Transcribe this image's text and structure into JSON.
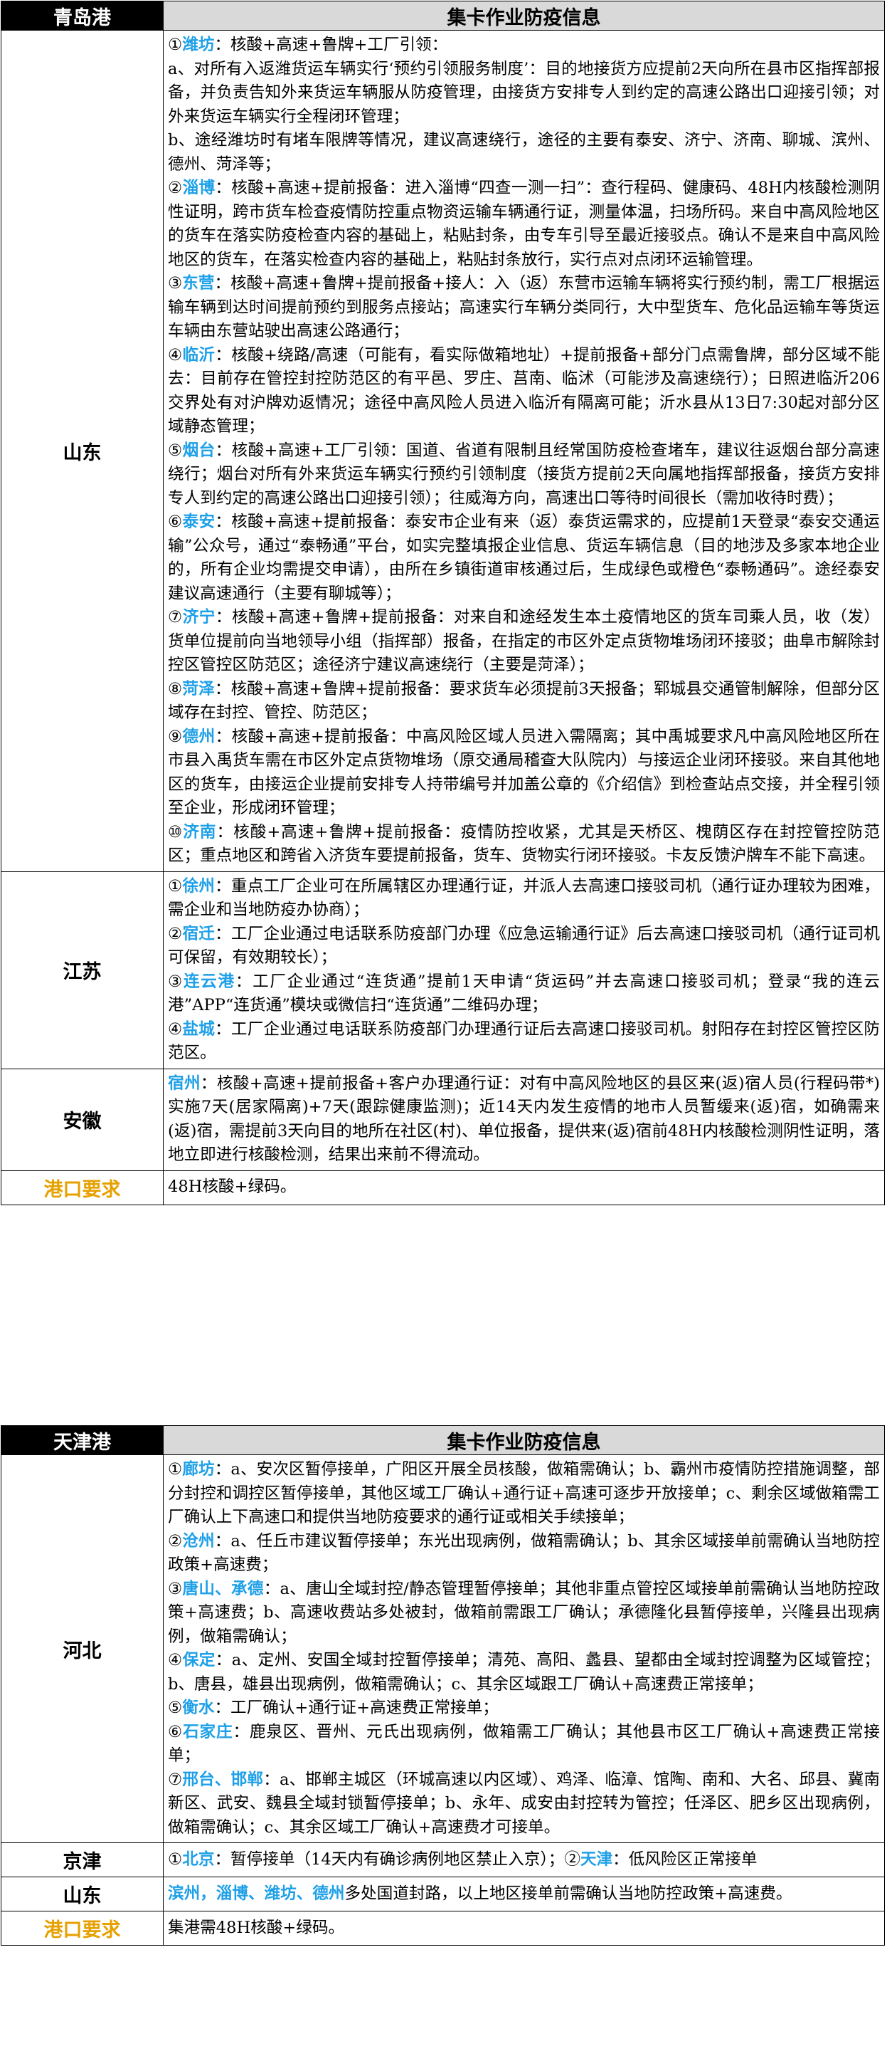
{
  "qingdao": {
    "header_port": "青岛港",
    "header_title": "集卡作业防疫信息",
    "shandong": {
      "region": "山东",
      "items": [
        {
          "num": "①",
          "city": "潍坊",
          "text": "：核酸+高速+鲁牌+工厂引领：\na、对所有入返潍货运车辆实行‘预约引领服务制度’：目的地接货方应提前2天向所在县市区指挥部报备，并负责告知外来货运车辆服从防疫管理，由接货方安排专人到约定的高速公路出口迎接引领；对外来货运车辆实行全程闭环管理；\nb、途经潍坊时有堵车限牌等情况，建议高速绕行，途径的主要有泰安、济宁、济南、聊城、滨州、德州、菏泽等；"
        },
        {
          "num": "②",
          "city": "淄博",
          "text": "：核酸+高速+提前报备：进入淄博“四查一测一扫”：查行程码、健康码、48H内核酸检测阴性证明，跨市货车检查疫情防控重点物资运输车辆通行证，测量体温，扫场所码。来自中高风险地区的货车在落实防疫检查内容的基础上，粘贴封条，由专车引导至最近接驳点。确认不是来自中高风险地区的货车，在落实检查内容的基础上，粘贴封条放行，实行点对点闭环运输管理。"
        },
        {
          "num": "③",
          "city": "东营",
          "text": "：核酸+高速+鲁牌+提前报备+接人：入（返）东营市运输车辆将实行预约制，需工厂根据运输车辆到达时间提前预约到服务点接站；高速实行车辆分类同行，大中型货车、危化品运输车等货运车辆由东营站驶出高速公路通行；"
        },
        {
          "num": "④",
          "city": "临沂",
          "text": "：核酸+绕路/高速（可能有，看实际做箱地址）+提前报备+部分门点需鲁牌，部分区域不能去：目前存在管控封控防范区的有平邑、罗庄、莒南、临沭（可能涉及高速绕行）；日照进临沂206交界处有对沪牌劝返情况；途径中高风险人员进入临沂有隔离可能；沂水县从13日7:30起对部分区域静态管理；"
        },
        {
          "num": "⑤",
          "city": "烟台",
          "text": "：核酸+高速+工厂引领：国道、省道有限制且经常国防疫检查堵车，建议往返烟台部分高速绕行；烟台对所有外来货运车辆实行预约引领制度（接货方提前2天向属地指挥部报备，接货方安排专人到约定的高速公路出口迎接引领）；往威海方向，高速出口等待时间很长（需加收待时费）；"
        },
        {
          "num": "⑥",
          "city": "泰安",
          "text": "：核酸+高速+提前报备：泰安市企业有来（返）泰货运需求的，应提前1天登录“泰安交通运输”公众号，通过“泰畅通”平台，如实完整填报企业信息、货运车辆信息（目的地涉及多家本地企业的，所有企业均需提交申请），由所在乡镇街道审核通过后，生成绿色或橙色“泰畅通码”。途经泰安建议高速通行（主要有聊城等）；"
        },
        {
          "num": "⑦",
          "city": "济宁",
          "text": "：核酸+高速+鲁牌+提前报备：对来自和途经发生本土疫情地区的货车司乘人员，收（发）货单位提前向当地领导小组（指挥部）报备，在指定的市区外定点货物堆场闭环接驳；曲阜市解除封控区管控区防范区；途径济宁建议高速绕行（主要是菏泽）；"
        },
        {
          "num": "⑧",
          "city": "菏泽",
          "text": "：核酸+高速+鲁牌+提前报备：要求货车必须提前3天报备；郓城县交通管制解除，但部分区域存在封控、管控、防范区；"
        },
        {
          "num": "⑨",
          "city": "德州",
          "text": "：核酸+高速+提前报备：中高风险区域人员进入需隔离；其中禹城要求凡中高风险地区所在市县入禹货车需在市区外定点货物堆场（原交通局稽查大队院内）与接运企业闭环接驳。来自其他地区的货车，由接运企业提前安排专人持带编号并加盖公章的《介绍信》到检查站点交接，并全程引领至企业，形成闭环管理；"
        },
        {
          "num": "⑩",
          "city": "济南",
          "text": "：核酸+高速+鲁牌+提前报备：疫情防控收紧，尤其是天桥区、槐荫区存在封控管控防范区；重点地区和跨省入济货车要提前报备，货车、货物实行闭环接驳。卡友反馈沪牌车不能下高速。"
        }
      ]
    },
    "jiangsu": {
      "region": "江苏",
      "items": [
        {
          "num": "①",
          "city": "徐州",
          "text": "：重点工厂企业可在所属辖区办理通行证，并派人去高速口接驳司机（通行证办理较为困难，需企业和当地防疫办协商）；"
        },
        {
          "num": "②",
          "city": "宿迁",
          "text": "：工厂企业通过电话联系防疫部门办理《应急运输通行证》后去高速口接驳司机（通行证司机可保留，有效期较长）；"
        },
        {
          "num": "③",
          "city": "连云港",
          "text": "：工厂企业通过“连货通”提前1天申请“货运码”并去高速口接驳司机；登录“我的连云港”APP“连货通”模块或微信扫“连货通”二维码办理；"
        },
        {
          "num": "④",
          "city": "盐城",
          "text": "：工厂企业通过电话联系防疫部门办理通行证后去高速口接驳司机。射阳存在封控区管控区防范区。"
        }
      ]
    },
    "anhui": {
      "region": "安徽",
      "items": [
        {
          "num": "",
          "city": "宿州",
          "text": "：核酸+高速+提前报备+客户办理通行证：对有中高风险地区的县区来(返)宿人员(行程码带*)实施7天(居家隔离)+7天(跟踪健康监测)；近14天内发生疫情的地市人员暂缓来(返)宿，如确需来(返)宿，需提前3天向目的地所在社区(村)、单位报备，提供来(返)宿前48H内核酸检测阴性证明，落地立即进行核酸检测，结果出来前不得流动。"
        }
      ]
    },
    "port_req": {
      "region": "港口要求",
      "text": "48H核酸+绿码。"
    }
  },
  "tianjin": {
    "header_port": "天津港",
    "header_title": "集卡作业防疫信息",
    "hebei": {
      "region": "河北",
      "items": [
        {
          "num": "①",
          "city": "廊坊",
          "text": "：a、安次区暂停接单，广阳区开展全员核酸，做箱需确认；b、霸州市疫情防控措施调整，部分封控和调控区暂停接单，其他区域工厂确认+通行证+高速可逐步开放接单；c、剩余区域做箱需工厂确认上下高速口和提供当地防疫要求的通行证或相关手续接单；"
        },
        {
          "num": "②",
          "city": "沧州",
          "text": "：a、任丘市建议暂停接单；东光出现病例，做箱需确认；b、其余区域接单前需确认当地防控政策+高速费；"
        },
        {
          "num": "③",
          "city": "唐山、承德",
          "text": "：a、唐山全域封控/静态管理暂停接单；其他非重点管控区域接单前需确认当地防控政策+高速费；b、高速收费站多处被封，做箱前需跟工厂确认；承德隆化县暂停接单，兴隆县出现病例，做箱需确认；"
        },
        {
          "num": "④",
          "city": "保定",
          "text": "：a、定州、安国全域封控暂停接单；清苑、高阳、蠡县、望都由全域封控调整为区域管控；b、唐县，雄县出现病例，做箱需确认；c、其余区域跟工厂确认+高速费正常接单；"
        },
        {
          "num": "⑤",
          "city": "衡水",
          "text": "：工厂确认+通行证+高速费正常接单；"
        },
        {
          "num": "⑥",
          "city": "石家庄",
          "text": "：鹿泉区、晋州、元氏出现病例，做箱需工厂确认；其他县市区工厂确认+高速费正常接单；"
        },
        {
          "num": "⑦",
          "city": "邢台、邯郸",
          "text": "：a、邯郸主城区（环城高速以内区域）、鸡泽、临漳、馆陶、南和、大名、邱县、冀南新区、武安、魏县全域封锁暂停接单；b、永年、成安由封控转为管控；任泽区、肥乡区出现病例，做箱需确认；c、其余区域工厂确认+高速费才可接单。"
        }
      ]
    },
    "jingjin": {
      "region": "京津",
      "items": [
        {
          "num": "①",
          "city": "北京",
          "text": "：暂停接单（14天内有确诊病例地区禁止入京）；"
        },
        {
          "num": "②",
          "city": "天津",
          "text": "：低风险区正常接单"
        }
      ]
    },
    "shandong": {
      "region": "山东",
      "items": [
        {
          "num": "",
          "city": "滨州，淄博、潍坊、德州",
          "text": "多处国道封路，以上地区接单前需确认当地防控政策+高速费。"
        }
      ]
    },
    "port_req": {
      "region": "港口要求",
      "text": "集港需48H核酸+绿码。"
    }
  },
  "colors": {
    "highlight": "#1ea0e8",
    "port_req": "#e6a000",
    "header_bg": "#000000",
    "sub_bg": "#d9d9d9"
  }
}
